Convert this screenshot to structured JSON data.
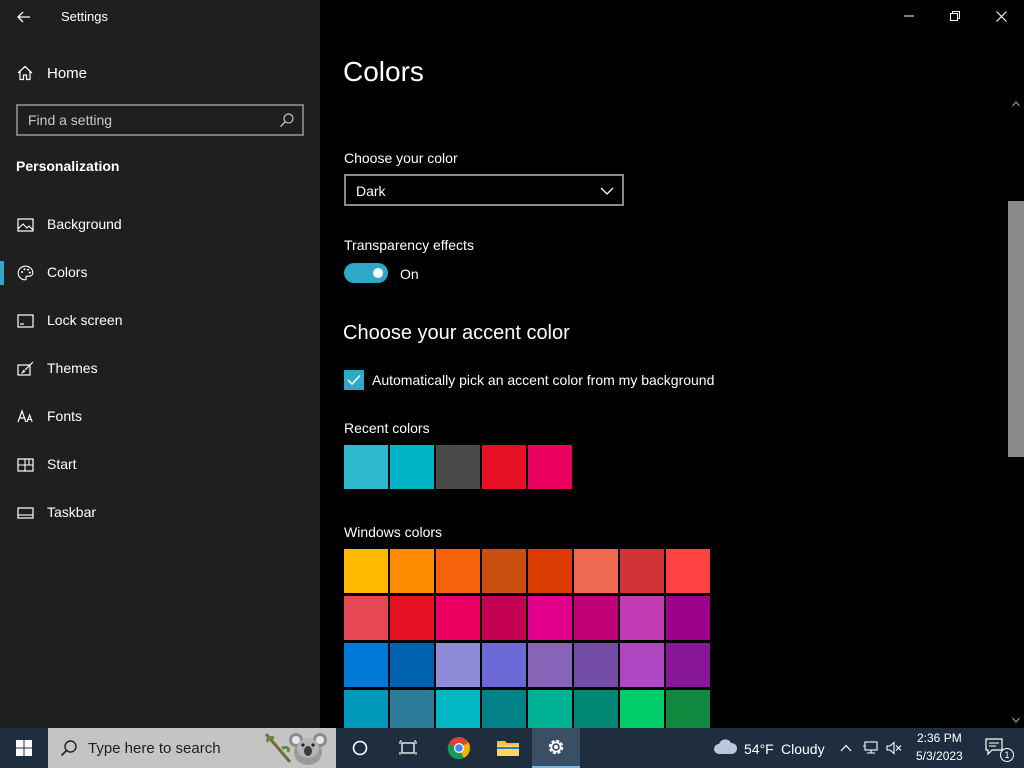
{
  "window": {
    "title": "Settings"
  },
  "sidebar": {
    "home_label": "Home",
    "search_placeholder": "Find a setting",
    "section_label": "Personalization",
    "items": [
      {
        "label": "Background",
        "icon": "image-icon",
        "selected": false
      },
      {
        "label": "Colors",
        "icon": "palette-icon",
        "selected": true
      },
      {
        "label": "Lock screen",
        "icon": "lock-screen-icon",
        "selected": false
      },
      {
        "label": "Themes",
        "icon": "brush-icon",
        "selected": false
      },
      {
        "label": "Fonts",
        "icon": "font-icon",
        "selected": false
      },
      {
        "label": "Start",
        "icon": "start-grid-icon",
        "selected": false
      },
      {
        "label": "Taskbar",
        "icon": "taskbar-icon",
        "selected": false
      }
    ]
  },
  "main": {
    "title": "Colors",
    "choose_color_label": "Choose your color",
    "choose_color_value": "Dark",
    "transparency_label": "Transparency effects",
    "transparency_state": "On",
    "accent_heading": "Choose your accent color",
    "auto_accent_label": "Automatically pick an accent color from my background",
    "auto_accent_checked": true,
    "recent_colors_label": "Recent colors",
    "recent_colors": [
      "#2fb9d0",
      "#00b4c8",
      "#4a4a4a",
      "#e81123",
      "#ea005e"
    ],
    "windows_colors_label": "Windows colors",
    "windows_colors": [
      [
        "#ffb900",
        "#ff8c00",
        "#f7630c",
        "#ca5010",
        "#da3b01",
        "#ef6950",
        "#d13438",
        "#ff4343"
      ],
      [
        "#e74856",
        "#e81123",
        "#ea005e",
        "#c30052",
        "#e3008c",
        "#bf0077",
        "#c239b3",
        "#9a0089"
      ],
      [
        "#0078d7",
        "#0063b1",
        "#8e8cd8",
        "#6b69d6",
        "#8764b8",
        "#744da9",
        "#b146c2",
        "#881798"
      ],
      [
        "#0099bc",
        "#2d7d9a",
        "#00b7c3",
        "#038387",
        "#00b294",
        "#018574",
        "#00cc6a",
        "#10893e"
      ]
    ]
  },
  "colors": {
    "accent": "#2ea8c6",
    "sidebar_bg": "#1f1f1f",
    "main_bg": "#000000",
    "taskbar_bg": "#1e2e3e"
  },
  "taskbar": {
    "search_placeholder": "Type here to search",
    "weather_temp": "54°F",
    "weather_desc": "Cloudy",
    "time": "2:36 PM",
    "date": "5/3/2023",
    "notification_count": "1"
  }
}
